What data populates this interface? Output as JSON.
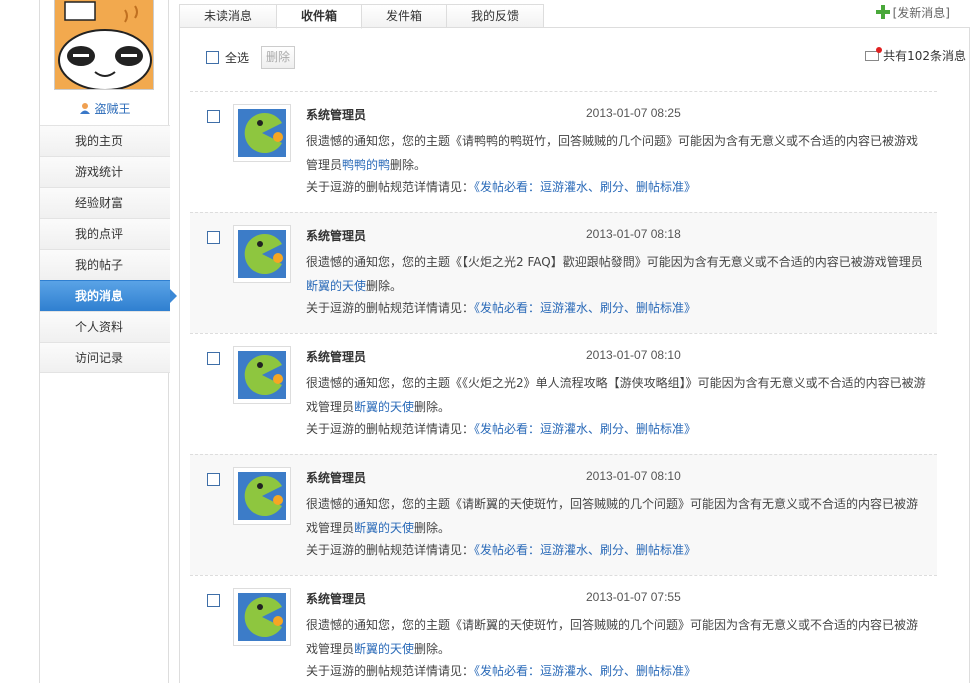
{
  "sidebar": {
    "username": "盗贼王",
    "nav": [
      {
        "label": "我的主页",
        "active": false
      },
      {
        "label": "游戏统计",
        "active": false
      },
      {
        "label": "经验财富",
        "active": false
      },
      {
        "label": "我的点评",
        "active": false
      },
      {
        "label": "我的帖子",
        "active": false
      },
      {
        "label": "我的消息",
        "active": true
      },
      {
        "label": "个人资料",
        "active": false
      },
      {
        "label": "访问记录",
        "active": false
      }
    ]
  },
  "tabs": [
    {
      "label": "未读消息",
      "active": false
    },
    {
      "label": "收件箱",
      "active": true
    },
    {
      "label": "发件箱",
      "active": false
    },
    {
      "label": "我的反馈",
      "active": false
    }
  ],
  "new_message_label": "[发新消息]",
  "toolbar": {
    "select_all_label": "全选",
    "delete_label": "删除",
    "total_text": "共有102条消息"
  },
  "messages": [
    {
      "sender": "系统管理员",
      "time": "2013-01-07 08:25",
      "body_before": "很遗憾的通知您，您的主题《请鸭鸭的鸭斑竹，回答贼贼的几个问题》可能因为含有无意义或不合适的内容已被游戏管理员",
      "admin": "鸭鸭的鸭",
      "body_after": "删除。",
      "rule_prefix": "关于逗游的删帖规范详情请见：",
      "rule_link": "《发帖必看：逗游灌水、刷分、删帖标准》"
    },
    {
      "sender": "系统管理员",
      "time": "2013-01-07 08:18",
      "body_before": "很遗憾的通知您，您的主题《【火炬之光2 FAQ】歡迎跟帖發問》可能因为含有无意义或不合适的内容已被游戏管理员",
      "admin": "断翼的天使",
      "body_after": "删除。",
      "rule_prefix": "关于逗游的删帖规范详情请见：",
      "rule_link": "《发帖必看：逗游灌水、刷分、删帖标准》"
    },
    {
      "sender": "系统管理员",
      "time": "2013-01-07 08:10",
      "body_before": "很遗憾的通知您，您的主题《《火炬之光2》单人流程攻略【游侠攻略组】》可能因为含有无意义或不合适的内容已被游戏管理员",
      "admin": "断翼的天使",
      "body_after": "删除。",
      "rule_prefix": "关于逗游的删帖规范详情请见：",
      "rule_link": "《发帖必看：逗游灌水、刷分、删帖标准》"
    },
    {
      "sender": "系统管理员",
      "time": "2013-01-07 08:10",
      "body_before": "很遗憾的通知您，您的主题《请断翼的天使斑竹，回答贼贼的几个问题》可能因为含有无意义或不合适的内容已被游戏管理员",
      "admin": "断翼的天使",
      "body_after": "删除。",
      "rule_prefix": "关于逗游的删帖规范详情请见：",
      "rule_link": "《发帖必看：逗游灌水、刷分、删帖标准》"
    },
    {
      "sender": "系统管理员",
      "time": "2013-01-07 07:55",
      "body_before": "很遗憾的通知您，您的主题《请断翼的天使斑竹，回答贼贼的几个问题》可能因为含有无意义或不合适的内容已被游戏管理员",
      "admin": "断翼的天使",
      "body_after": "删除。",
      "rule_prefix": "关于逗游的删帖规范详情请见：",
      "rule_link": "《发帖必看：逗游灌水、刷分、删帖标准》"
    }
  ]
}
